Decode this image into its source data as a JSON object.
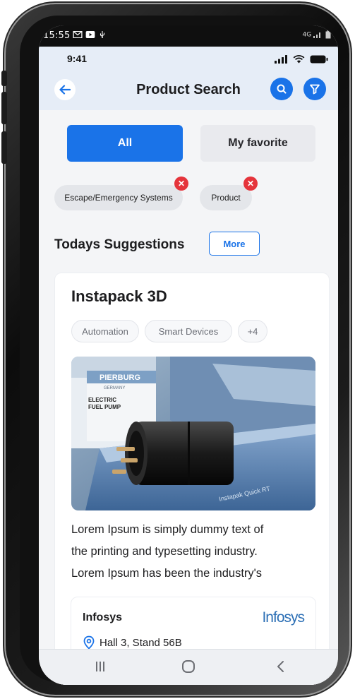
{
  "android_status": {
    "time": "15:55",
    "network": "4G"
  },
  "ios_status": {
    "time": "9:41"
  },
  "header": {
    "title": "Product Search"
  },
  "tabs": [
    {
      "label": "All",
      "active": true
    },
    {
      "label": "My favorite",
      "active": false
    }
  ],
  "filters": [
    {
      "label": "Escape/Emergency Systems"
    },
    {
      "label": "Product"
    }
  ],
  "suggestions": {
    "title": "Todays Suggestions",
    "more_label": "More"
  },
  "card": {
    "title": "Instapack 3D",
    "tags": [
      "Automation",
      "Smart Devices",
      "+4"
    ],
    "image_text": {
      "box_brand": "PIERBURG",
      "box_sub": "GERMANY",
      "box_line1": "ELECTRIC",
      "box_line2": "FUEL PUMP",
      "machine_label": "Instapak Quick RT"
    },
    "description_lines": [
      "Lorem Ipsum is simply dummy text of",
      "the printing and typesetting industry.",
      "Lorem Ipsum has been the industry's"
    ],
    "company": {
      "name": "Infosys",
      "logo_text": "Infosys",
      "location": "Hall 3, Stand 56B"
    }
  },
  "colors": {
    "primary": "#1a73e8",
    "danger": "#e5343b",
    "header_bg": "#e6edf7",
    "logo_blue": "#2c6fb5"
  }
}
